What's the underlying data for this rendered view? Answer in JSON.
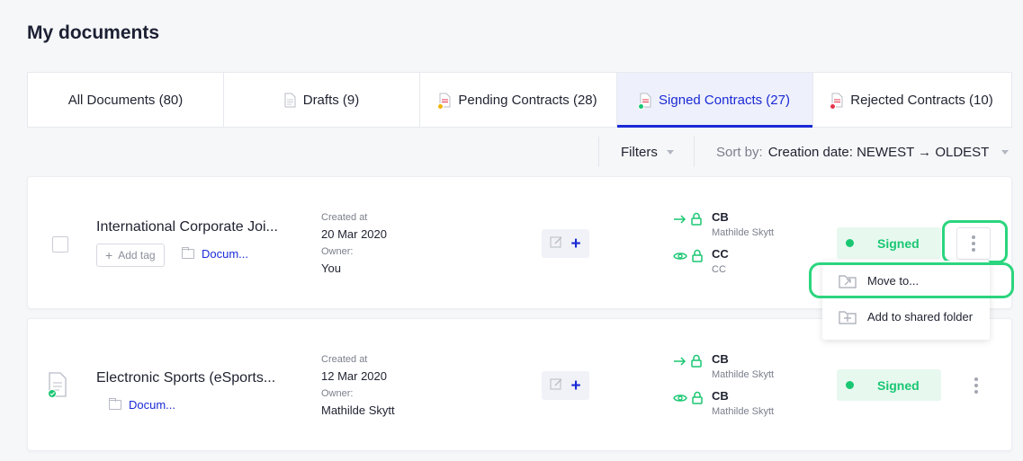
{
  "page": {
    "title": "My documents"
  },
  "tabs": [
    {
      "label": "All Documents (80)",
      "icon": "",
      "active": false
    },
    {
      "label": "Drafts (9)",
      "icon": "draft-doc-icon",
      "active": false
    },
    {
      "label": "Pending Contracts (28)",
      "icon": "pending-doc-icon",
      "active": false
    },
    {
      "label": "Signed Contracts (27)",
      "icon": "signed-doc-icon",
      "active": true
    },
    {
      "label": "Rejected Contracts (10)",
      "icon": "rejected-doc-icon",
      "active": false
    }
  ],
  "toolbar": {
    "filters_label": "Filters",
    "sort_label": "Sort by:",
    "sort_value": "Creation date: NEWEST → OLDEST"
  },
  "colors": {
    "accent": "#1a2ad6",
    "signed": "#19c772",
    "pending": "#f0b400",
    "rejected": "#e5344b",
    "highlight": "#2bd57e"
  },
  "documents": [
    {
      "title": "International Corporate Joi...",
      "add_tag_label": "Add tag",
      "folder_label": "Docum...",
      "created_label": "Created at",
      "created_value": "20 Mar 2020",
      "owner_label": "Owner:",
      "owner_value": "You",
      "recipients": [
        {
          "initials": "CB",
          "sub": "Mathilde Skytt",
          "role_icon": "arrow-right-icon"
        },
        {
          "initials": "CC",
          "sub": "CC",
          "role_icon": "eye-icon"
        }
      ],
      "status": "Signed"
    },
    {
      "title": "Electronic Sports (eSports...",
      "folder_label": "Docum...",
      "created_label": "Created at",
      "created_value": "12 Mar 2020",
      "owner_label": "Owner:",
      "owner_value": "Mathilde Skytt",
      "recipients": [
        {
          "initials": "CB",
          "sub": "Mathilde Skytt",
          "role_icon": "arrow-right-icon"
        },
        {
          "initials": "CB",
          "sub": "Mathilde Skytt",
          "role_icon": "eye-icon"
        }
      ],
      "status": "Signed"
    }
  ],
  "menu": {
    "items": [
      {
        "label": "Move to...",
        "icon": "move-to-icon"
      },
      {
        "label": "Add to shared folder",
        "icon": "shared-folder-icon"
      }
    ]
  }
}
